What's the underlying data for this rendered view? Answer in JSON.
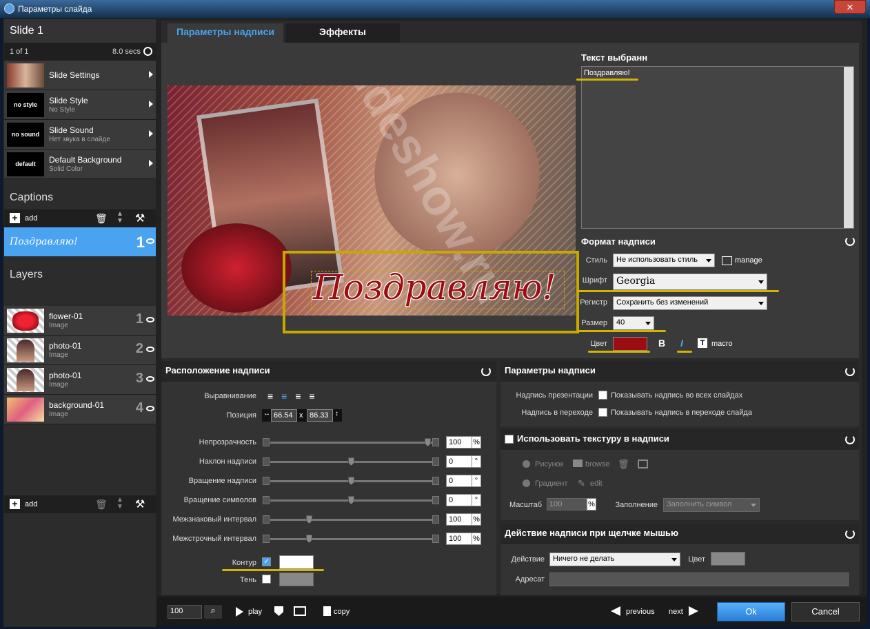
{
  "window": {
    "title": "Параметры слайда"
  },
  "sidebar": {
    "slide_title": "Slide 1",
    "counter": "1 of 1",
    "duration": "8.0 secs",
    "items": [
      {
        "thumb": "",
        "title": "Slide Settings",
        "sub": ""
      },
      {
        "thumb": "no style",
        "title": "Slide Style",
        "sub": "No Style"
      },
      {
        "thumb": "no sound",
        "title": "Slide Sound",
        "sub": "Нет звука в слайде"
      },
      {
        "thumb": "default",
        "title": "Default Background",
        "sub": "Solid Color"
      }
    ],
    "captions_title": "Captions",
    "add_label": "add",
    "caption": {
      "text": "Поздравляю!",
      "num": "1"
    },
    "layers_title": "Layers",
    "layers": [
      {
        "name": "flower-01",
        "type": "Image",
        "num": "1"
      },
      {
        "name": "photo-01",
        "type": "Image",
        "num": "2"
      },
      {
        "name": "photo-01",
        "type": "Image",
        "num": "3"
      },
      {
        "name": "background-01",
        "type": "Image",
        "num": "4"
      }
    ]
  },
  "tabs": {
    "active": "Параметры надписи",
    "other": "Эффекты"
  },
  "preview": {
    "caption": "Поздравляю!",
    "watermark": "slideshow.ru"
  },
  "text_panel": {
    "title": "Текст выбранн",
    "text": "Поздравляю!"
  },
  "format": {
    "title": "Формат надписи",
    "style_label": "Стиль",
    "style_value": "Не использовать стиль",
    "manage": "manage",
    "font_label": "Шрифт",
    "font_value": "Georgia",
    "case_label": "Регистр",
    "case_value": "Сохранить без изменений",
    "size_label": "Размер",
    "size_value": "40",
    "color_label": "Цвет",
    "color_value": "#9b0d12",
    "bold": "B",
    "italic": "I",
    "macro": "macro"
  },
  "layout": {
    "title": "Расположение надписи",
    "align_label": "Выравнивание",
    "pos_label": "Позиция",
    "pos_x": "66.54",
    "pos_sep": "x",
    "pos_y": "86.33",
    "sliders": [
      {
        "label": "Непрозрачность",
        "value": "100",
        "unit": "%",
        "level": 0.99
      },
      {
        "label": "Наклон надписи",
        "value": "0",
        "unit": "°",
        "level": 0.5
      },
      {
        "label": "Вращение надписи",
        "value": "0",
        "unit": "°",
        "level": 0.5
      },
      {
        "label": "Вращение символов",
        "value": "0",
        "unit": "°",
        "level": 0.5
      },
      {
        "label": "Межзнаковый интервал",
        "value": "100",
        "unit": "%",
        "level": 0.23
      },
      {
        "label": "Межстрочный интервал",
        "value": "100",
        "unit": "%",
        "level": 0.23
      }
    ],
    "outline_label": "Контур",
    "shadow_label": "Тень"
  },
  "params": {
    "title": "Параметры надписи",
    "row1_label": "Надпись презентации",
    "row1_text": "Показывать надпись во всех слайдах",
    "row2_label": "Надпись в переходе",
    "row2_text": "Показывать надпись в переходе слайда"
  },
  "texture": {
    "title": "Использовать текстуру в надписи",
    "picture": "Рисунок",
    "browse": "browse",
    "gradient": "Градиент",
    "edit": "edit",
    "scale_label": "Масштаб",
    "scale_value": "100",
    "scale_unit": "%",
    "fill_label": "Заполнение",
    "fill_value": "Заполнить символ"
  },
  "action": {
    "title": "Действие надписи при щелчке мышью",
    "action_label": "Действие",
    "action_value": "Ничего не делать",
    "color_label": "Цвет",
    "addr_label": "Адресат"
  },
  "bottom": {
    "zoom": "100",
    "play": "play",
    "copy": "copy",
    "previous": "previous",
    "next": "next",
    "ok": "Ok",
    "cancel": "Cancel"
  }
}
